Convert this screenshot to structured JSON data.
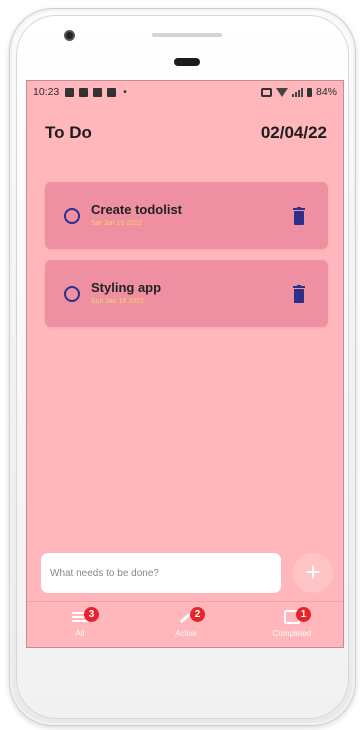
{
  "status_bar": {
    "time": "10:23",
    "left_dot": "•",
    "battery": "84%"
  },
  "header": {
    "title": "To Do",
    "date": "02/04/22"
  },
  "todos": [
    {
      "title": "Create todolist",
      "date": "Sat Jan 15 2022"
    },
    {
      "title": "Styling app",
      "date": "Sun Jan 16 2022"
    }
  ],
  "input": {
    "placeholder": "What needs to be done?",
    "add_label": "+"
  },
  "tabs": [
    {
      "label": "All",
      "badge": "3",
      "icon": "list-icon"
    },
    {
      "label": "Active",
      "badge": "2",
      "icon": "pencil-icon"
    },
    {
      "label": "Completed",
      "badge": "1",
      "icon": "checkbox-icon"
    }
  ],
  "colors": {
    "background": "#ffb7bb",
    "card": "#ee8fa2",
    "accent": "#2b2e8a",
    "date_text": "#f6d36a",
    "badge": "#e8232d"
  }
}
